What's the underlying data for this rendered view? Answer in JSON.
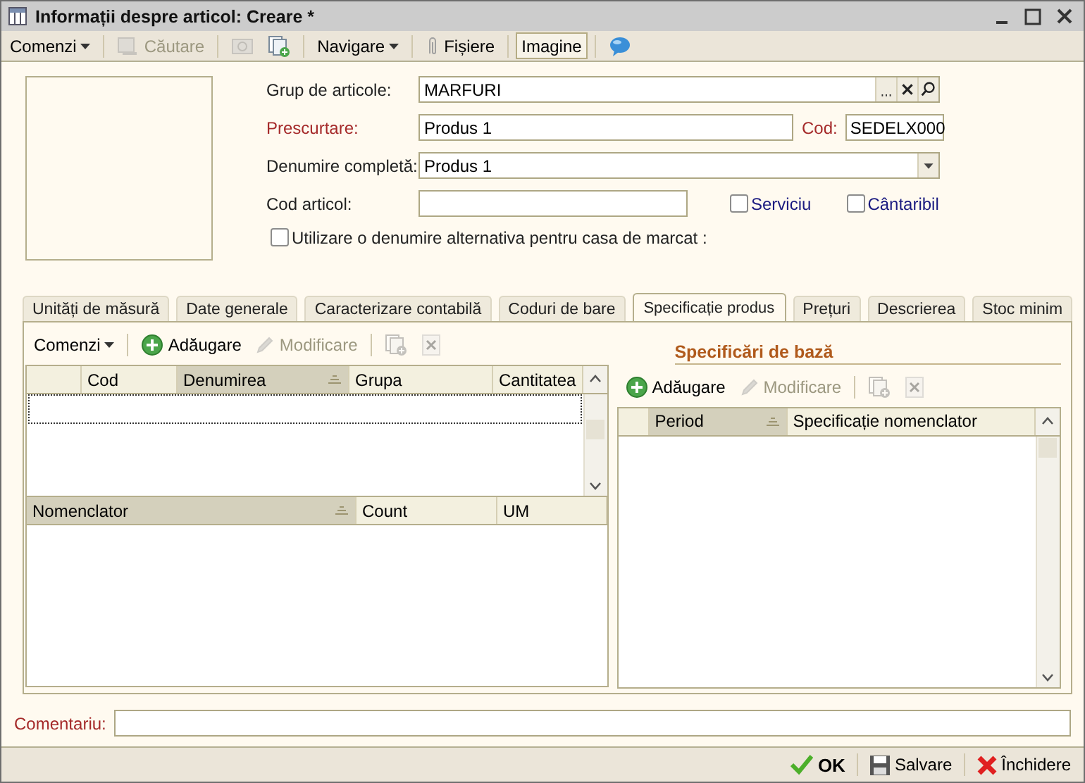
{
  "window": {
    "title": "Informații despre articol: Creare *"
  },
  "toolbar": [
    {
      "kind": "menu",
      "label": "Comenzi"
    },
    {
      "kind": "separator"
    },
    {
      "kind": "button",
      "label": "Căutare",
      "disabled": true
    },
    {
      "kind": "separator"
    },
    {
      "kind": "button",
      "disabled": true
    },
    {
      "kind": "button",
      "disabled": false
    },
    {
      "kind": "separator"
    },
    {
      "kind": "menu",
      "label": "Navigare"
    },
    {
      "kind": "separator"
    },
    {
      "kind": "button",
      "label": "Fișiere",
      "disabled": false
    },
    {
      "kind": "separator"
    },
    {
      "kind": "toggle",
      "label": "Imagine",
      "pressed": true
    },
    {
      "kind": "separator"
    },
    {
      "kind": "button",
      "disabled": false
    }
  ],
  "form": {
    "group": {
      "label": "Grup de articole:",
      "value": "MARFURI",
      "required": false
    },
    "short_name": {
      "label": "Prescurtare:",
      "value": "Produs 1",
      "required": true
    },
    "code": {
      "label": "Cod:",
      "value": "SEDELX000",
      "required": true
    },
    "full_name": {
      "label": "Denumire completă:",
      "value": "Produs 1",
      "required": false
    },
    "article_code": {
      "label": "Cod articol:",
      "required": false
    },
    "flags": [
      {
        "label": "Serviciu",
        "checked": false
      },
      {
        "label": "Cântaribil",
        "checked": false
      }
    ],
    "alt_name": {
      "label": "Utilizare o denumire alternativa pentru casa de marcat :",
      "checked": false
    }
  },
  "tabs": [
    {
      "label": "Unități de măsură",
      "selected": false
    },
    {
      "label": "Date generale",
      "selected": false
    },
    {
      "label": "Caracterizare contabilă",
      "selected": false
    },
    {
      "label": "Coduri de bare",
      "selected": false
    },
    {
      "label": "Specificație produs",
      "selected": true
    },
    {
      "label": "Prețuri",
      "selected": false
    },
    {
      "label": "Descrierea",
      "selected": false
    },
    {
      "label": "Stoc minim",
      "selected": false
    }
  ],
  "left_panel": {
    "toolbar": [
      {
        "kind": "menu",
        "label": "Comenzi"
      },
      {
        "kind": "separator"
      },
      {
        "kind": "button",
        "label": "Adăugare",
        "disabled": false
      },
      {
        "kind": "button",
        "label": "Modificare",
        "disabled": true
      },
      {
        "kind": "separator"
      },
      {
        "kind": "button",
        "disabled": true
      },
      {
        "kind": "button",
        "disabled": true
      }
    ],
    "grid": {
      "columns": [
        {
          "label": "Cod",
          "sorted": false
        },
        {
          "label": "Denumirea",
          "sorted": true
        },
        {
          "label": "Grupa",
          "sorted": false
        },
        {
          "label": "Cantitatea",
          "sorted": false
        }
      ]
    },
    "lower_grid": {
      "columns": [
        {
          "label": "Nomenclator",
          "sorted": true
        },
        {
          "label": "Count",
          "sorted": false
        },
        {
          "label": "UM",
          "sorted": false
        }
      ]
    }
  },
  "right_panel": {
    "title": "Specificări de bază",
    "toolbar": [
      {
        "kind": "button",
        "label": "Adăugare",
        "disabled": false
      },
      {
        "kind": "button",
        "label": "Modificare",
        "disabled": true
      },
      {
        "kind": "separator"
      },
      {
        "kind": "button",
        "disabled": true
      },
      {
        "kind": "button",
        "disabled": true
      }
    ],
    "grid": {
      "columns": [
        {
          "label": "Period",
          "sorted": true
        },
        {
          "label": "Specificație nomenclator",
          "sorted": false
        }
      ]
    }
  },
  "comment": {
    "label": "Comentariu:",
    "required": true
  },
  "footer": [
    {
      "label": "OK",
      "default": true
    },
    {
      "label": "Salvare",
      "default": false
    },
    {
      "label": "Închidere",
      "default": false
    }
  ]
}
